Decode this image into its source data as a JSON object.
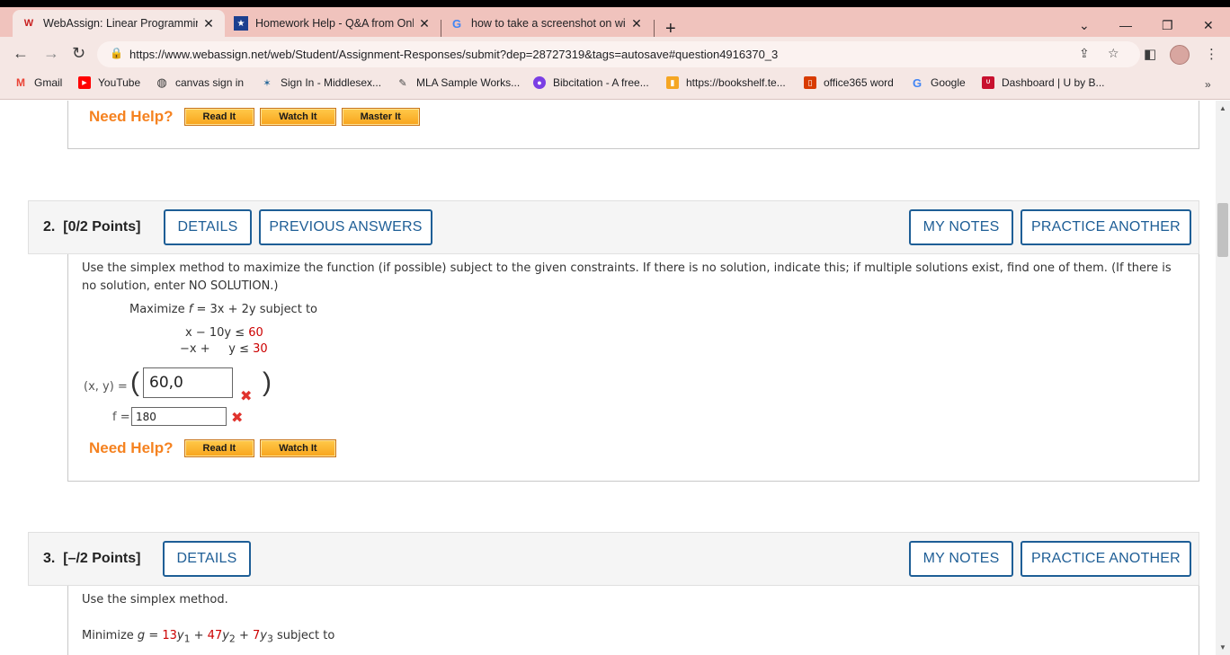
{
  "tabs": [
    {
      "title": "WebAssign: Linear Programming",
      "icon": "webassign-icon",
      "active": true
    },
    {
      "title": "Homework Help - Q&A from Onl",
      "icon": "star-icon",
      "active": false
    },
    {
      "title": "how to take a screenshot on wind",
      "icon": "google-icon",
      "active": false
    }
  ],
  "url": "https://www.webassign.net/web/Student/Assignment-Responses/submit?dep=28727319&tags=autosave#question4916370_3",
  "bookmarks": [
    {
      "label": "Gmail",
      "icon": "gmail-icon",
      "color": "#ea4335"
    },
    {
      "label": "YouTube",
      "icon": "youtube-icon",
      "color": "#ff0000"
    },
    {
      "label": "canvas sign in",
      "icon": "globe-icon",
      "color": "#333333"
    },
    {
      "label": "Sign In - Middlesex...",
      "icon": "middlesex-icon",
      "color": "#2a6a9a"
    },
    {
      "label": "MLA Sample Works...",
      "icon": "mla-icon",
      "color": "#444444"
    },
    {
      "label": "Bibcitation - A free...",
      "icon": "bibcitation-icon",
      "color": "#7b3fe4"
    },
    {
      "label": "https://bookshelf.te...",
      "icon": "bookshelf-icon",
      "color": "#f5a623"
    },
    {
      "label": "office365 word",
      "icon": "office-icon",
      "color": "#d83b01"
    },
    {
      "label": "Google",
      "icon": "google-icon",
      "color": "#4285f4"
    },
    {
      "label": "Dashboard | U by B...",
      "icon": "ubyb-icon",
      "color": "#c8102e"
    }
  ],
  "need_help": {
    "label": "Need Help?",
    "read": "Read It",
    "watch": "Watch It",
    "master": "Master It"
  },
  "q2": {
    "number": "2.",
    "points": "[0/2 Points]",
    "details": "DETAILS",
    "previous": "PREVIOUS ANSWERS",
    "my_notes": "MY NOTES",
    "practice": "PRACTICE ANOTHER",
    "prompt": "Use the simplex method to maximize the function (if possible) subject to the given constraints. If there is no solution, indicate this; if multiple solutions exist, find one of them. (If there is",
    "prompt2": "no solution, enter NO SOLUTION.)",
    "maximize_prefix": "Maximize",
    "f_var": "f",
    "objective": " = 3x + 2y subject to",
    "c1_lhs": "x − 10y ≤",
    "c1_rhs": "60",
    "c2_lhs": "−x +     y ≤",
    "c2_rhs": "30",
    "xy_label": "(x, y) =",
    "xy_value": "60,0",
    "f_label": "f =",
    "f_value": "180"
  },
  "q3": {
    "number": "3.",
    "points": "[–/2 Points]",
    "details": "DETAILS",
    "my_notes": "MY NOTES",
    "practice": "PRACTICE ANOTHER",
    "prompt": "Use the simplex method.",
    "minimize_prefix": "Minimize",
    "g_var": "g",
    "eq": " = ",
    "c1": "13",
    "c2": "47",
    "c3": "7",
    "suffix": " subject to"
  }
}
